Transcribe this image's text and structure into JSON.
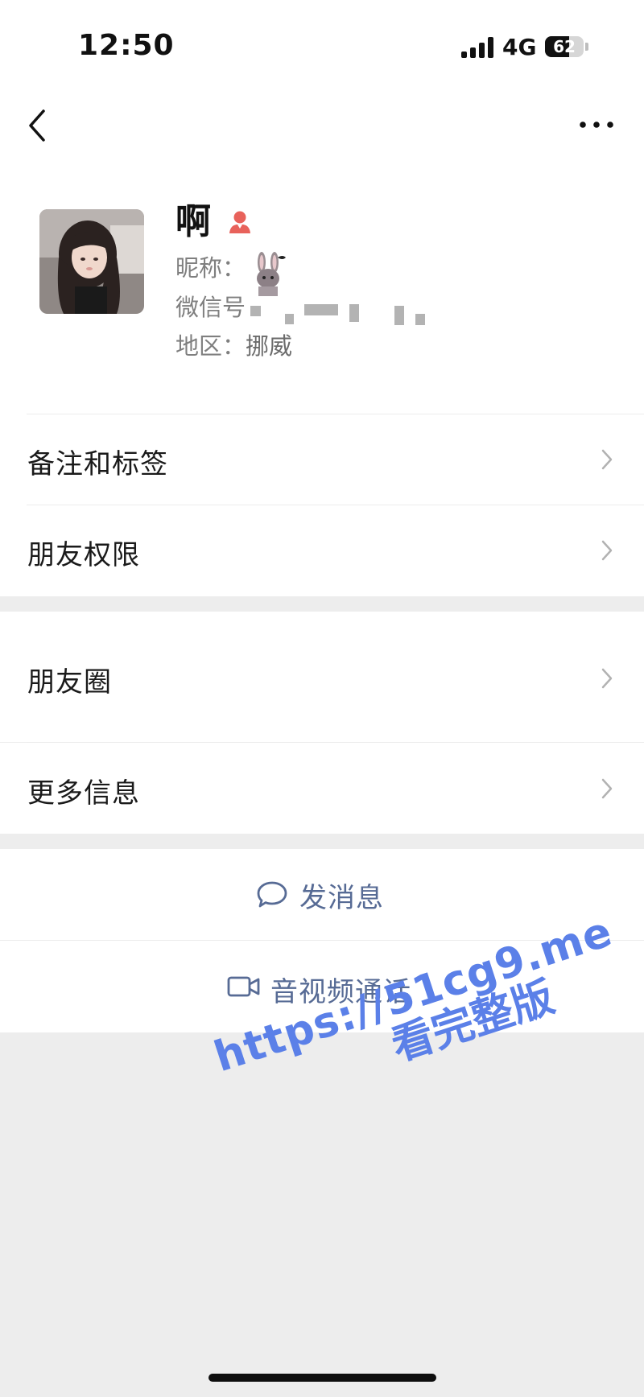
{
  "status_bar": {
    "time": "12:50",
    "network": "4G",
    "battery": "62",
    "battery_fraction": 0.62
  },
  "nav": {
    "back_icon": "chevron-left-icon",
    "more_icon": "ellipsis-icon"
  },
  "profile": {
    "name": "啊",
    "gender_icon": "female-user-icon",
    "gender_color": "#e8625b",
    "nickname_label": "昵称：",
    "wechat_id_label": "微信号",
    "region_label": "地区：",
    "region_value": "挪威"
  },
  "rows_group1": [
    {
      "label": "备注和标签"
    },
    {
      "label": "朋友权限"
    }
  ],
  "rows_group2": [
    {
      "label": "朋友圈"
    },
    {
      "label": "更多信息"
    }
  ],
  "actions": {
    "message": "发消息",
    "call": "音视频通话",
    "link_color": "#576b95"
  },
  "watermark": {
    "line1": "https://51cg9.me",
    "line2": "看完整版",
    "color": "#5b80e8"
  }
}
